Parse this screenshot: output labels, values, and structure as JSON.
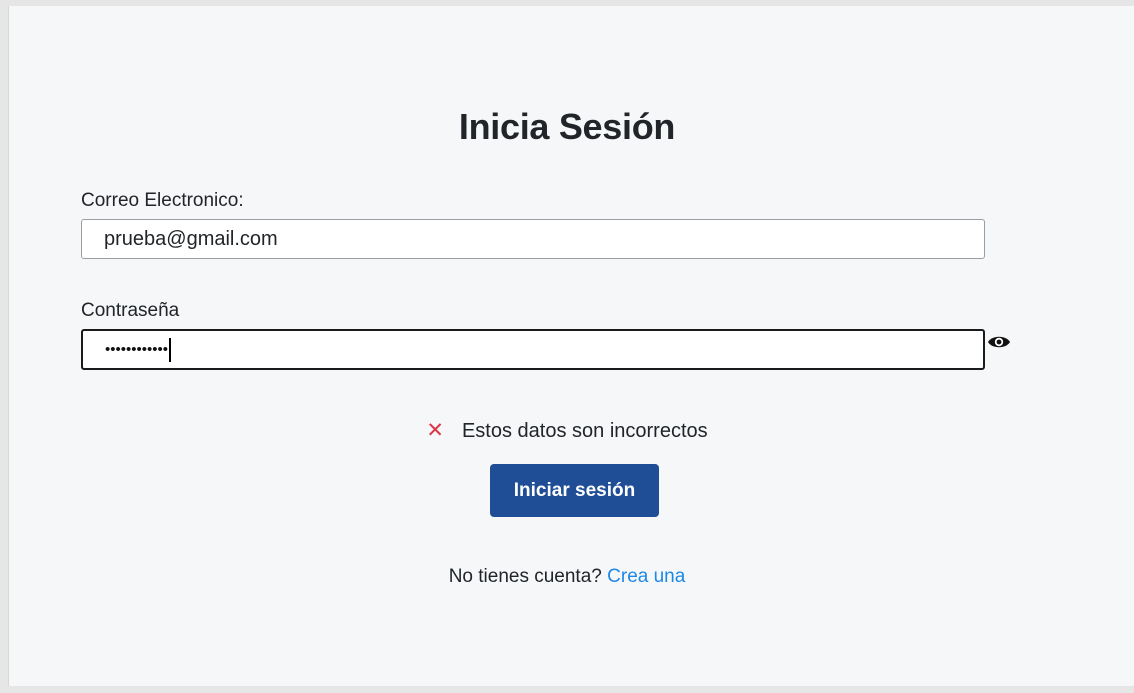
{
  "login": {
    "title": "Inicia Sesión",
    "email_label": "Correo Electronico:",
    "email_value": "prueba@gmail.com",
    "password_label": "Contraseña",
    "password_mask": "••••••••••••",
    "error_message": "Estos datos son incorrectos",
    "submit_label": "Iniciar sesión",
    "signup_prompt": "No tienes cuenta?",
    "signup_link": "Crea una"
  },
  "icons": {
    "error": "x-icon",
    "toggle_password": "eye-icon"
  },
  "colors": {
    "primary_button": "#1f4e96",
    "error_icon": "#dc3545",
    "link": "#1e88e5",
    "background": "#f6f7f9"
  }
}
